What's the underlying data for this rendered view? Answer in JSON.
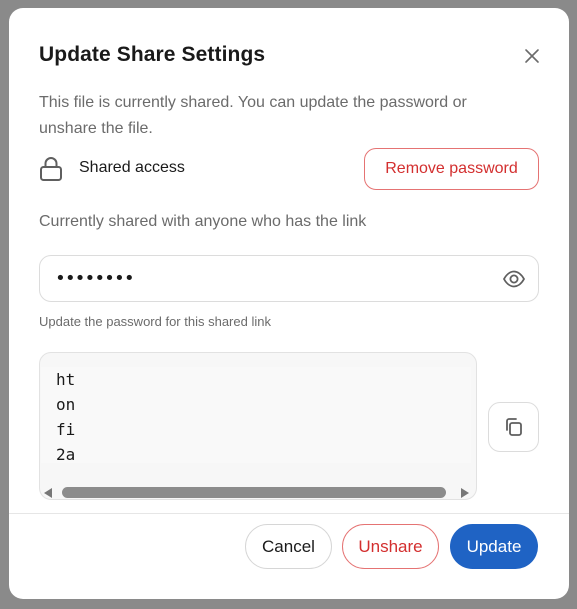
{
  "dialog": {
    "title": "Update Share Settings",
    "description": "This file is currently shared. You can update the password or unshare the file."
  },
  "access": {
    "label": "Shared access",
    "remove_password_label": "Remove password"
  },
  "shared_with": "Currently shared with anyone who has the link",
  "password": {
    "masked_value": "••••••••",
    "hint": "Update the password for this shared link"
  },
  "link": {
    "lines": [
      "ht",
      "on",
      "fi",
      "2a"
    ]
  },
  "footer": {
    "cancel_label": "Cancel",
    "unshare_label": "Unshare",
    "update_label": "Update"
  },
  "colors": {
    "accent": "#1f63c4",
    "danger": "#d32f2f"
  },
  "icons": {
    "close": "close-icon",
    "lock": "lock-icon",
    "eye": "eye-icon",
    "copy": "copy-icon"
  }
}
